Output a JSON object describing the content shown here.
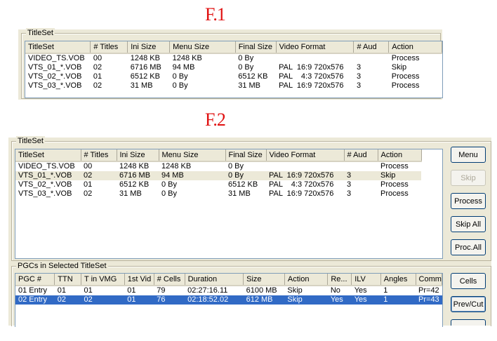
{
  "labels": {
    "f1": "F.1",
    "f2": "F.2"
  },
  "f1": {
    "group_title": "TitleSet",
    "columns": [
      "TitleSet",
      "# Titles",
      "Ini Size",
      "Menu Size",
      "Final Size",
      "Video Format",
      "# Aud",
      "Action"
    ],
    "rows": [
      [
        "VIDEO_TS.VOB",
        "00",
        "1248 KB",
        "1248 KB",
        "0 By",
        "",
        "",
        "Process"
      ],
      [
        "VTS_01_*.VOB",
        "02",
        "6716 MB",
        "94 MB",
        "0 By",
        "PAL  16:9 720x576",
        "3",
        "Skip"
      ],
      [
        "VTS_02_*.VOB",
        "01",
        "6512 KB",
        "0 By",
        "6512 KB",
        "PAL    4:3 720x576",
        "3",
        "Process"
      ],
      [
        "VTS_03_*.VOB",
        "02",
        "31 MB",
        "0 By",
        "31 MB",
        "PAL  16:9 720x576",
        "3",
        "Process"
      ]
    ]
  },
  "f2": {
    "titleset_group_title": "TitleSet",
    "columns": [
      "TitleSet",
      "# Titles",
      "Ini Size",
      "Menu Size",
      "Final Size",
      "Video Format",
      "# Aud",
      "Action"
    ],
    "rows": [
      [
        "VIDEO_TS.VOB",
        "00",
        "1248 KB",
        "1248 KB",
        "0 By",
        "",
        "",
        "Process"
      ],
      [
        "VTS_01_*.VOB",
        "02",
        "6716 MB",
        "94 MB",
        "0 By",
        "PAL  16:9 720x576",
        "3",
        "Skip"
      ],
      [
        "VTS_02_*.VOB",
        "01",
        "6512 KB",
        "0 By",
        "6512 KB",
        "PAL    4:3 720x576",
        "3",
        "Process"
      ],
      [
        "VTS_03_*.VOB",
        "02",
        "31 MB",
        "0 By",
        "31 MB",
        "PAL  16:9 720x576",
        "3",
        "Process"
      ]
    ],
    "buttons": {
      "menu": "Menu",
      "skip": "Skip",
      "process": "Process",
      "skip_all": "Skip All",
      "proc_all": "Proc.All"
    },
    "pgc_group_title": "PGCs in Selected TitleSet",
    "pgc_columns": [
      "PGC #",
      "TTN",
      "T in VMG",
      "1st Vid",
      "# Cells",
      "Duration",
      "Size",
      "Action",
      "Re...",
      "ILV",
      "Angles",
      "Comm"
    ],
    "pgc_rows": [
      [
        "01 Entry",
        "01",
        "01",
        "01",
        "79",
        "02:27:16.11",
        "6100 MB",
        "Skip",
        "No",
        "Yes",
        "1",
        "Pr=42"
      ],
      [
        "02 Entry",
        "02",
        "02",
        "01",
        "76",
        "02:18:52.02",
        "612 MB",
        "Skip",
        "Yes",
        "Yes",
        "1",
        "Pr=43"
      ]
    ],
    "pgc_buttons": {
      "cells": "Cells",
      "prev_cut": "Prev/Cut"
    }
  }
}
